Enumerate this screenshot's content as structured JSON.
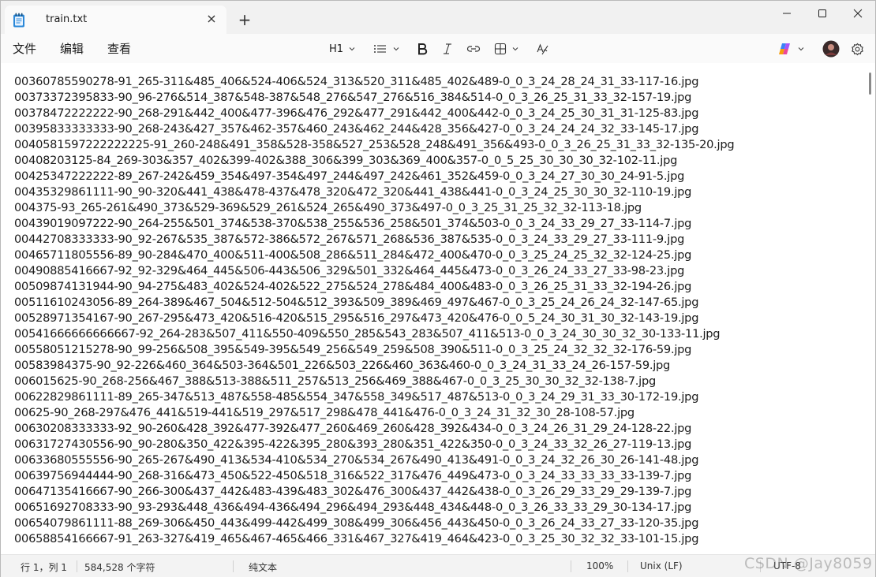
{
  "window": {
    "tab_title": "train.txt",
    "tab_close_label": "×",
    "new_tab_label": "+"
  },
  "menu": {
    "file": "文件",
    "edit": "编辑",
    "view": "查看"
  },
  "toolbar": {
    "heading_label": "H1",
    "icons": [
      "list-icon",
      "bold-icon",
      "italic-icon",
      "link-icon",
      "table-icon",
      "clear-format-icon",
      "copilot-icon",
      "avatar",
      "settings-icon"
    ]
  },
  "editor": {
    "lines": [
      "00360785590278-91_265-311&485_406&524-406&524_313&520_311&485_402&489-0_0_3_24_28_24_31_33-117-16.jpg",
      "00373372395833-90_96-276&514_387&548-387&548_276&547_276&516_384&514-0_0_3_26_25_31_33_32-157-19.jpg",
      "00378472222222-90_268-291&442_400&477-396&476_292&477_291&442_400&442-0_0_3_24_25_30_31_31-125-83.jpg",
      "00395833333333-90_268-243&427_357&462-357&460_243&462_244&428_356&427-0_0_3_24_24_24_32_33-145-17.jpg",
      "0040581597222222225-91_260-248&491_358&528-358&527_253&528_248&491_356&493-0_0_3_26_25_31_33_32-135-20.jpg",
      "00408203125-84_269-303&357_402&399-402&388_306&399_303&369_400&357-0_0_5_25_30_30_30_32-102-11.jpg",
      "00425347222222-89_267-242&459_354&497-354&497_244&497_242&461_352&459-0_0_3_24_27_30_30_24-91-5.jpg",
      "00435329861111-90_90-320&441_438&478-437&478_320&472_320&441_438&441-0_0_3_24_25_30_30_32-110-19.jpg",
      "004375-93_265-261&490_373&529-369&529_261&524_265&490_373&497-0_0_3_25_31_25_32_32-113-18.jpg",
      "00439019097222-90_264-255&501_374&538-370&538_255&536_258&501_374&503-0_0_3_24_33_29_27_33-114-7.jpg",
      "00442708333333-90_92-267&535_387&572-386&572_267&571_268&536_387&535-0_0_3_24_33_29_27_33-111-9.jpg",
      "00465711805556-89_90-284&470_400&511-400&508_286&511_284&472_400&470-0_0_3_25_24_25_32_32-124-25.jpg",
      "00490885416667-92_92-329&464_445&506-443&506_329&501_332&464_445&473-0_0_3_26_24_33_27_33-98-23.jpg",
      "00509874131944-90_94-275&483_402&524-402&522_275&524_278&484_400&483-0_0_3_26_25_31_33_32-194-26.jpg",
      "00511610243056-89_264-389&467_504&512-504&512_393&509_389&469_497&467-0_0_3_25_24_26_24_32-147-65.jpg",
      "00528971354167-90_267-295&473_420&516-420&515_295&516_297&473_420&476-0_0_5_24_30_31_30_32-143-19.jpg",
      "00541666666666667-92_264-283&507_411&550-409&550_285&543_283&507_411&513-0_0_3_24_30_30_32_30-133-11.jpg",
      "00558051215278-90_99-256&508_395&549-395&549_256&549_259&508_390&511-0_0_3_25_24_32_32_32-176-59.jpg",
      "00583984375-90_92-226&460_364&503-364&501_226&503_226&460_363&460-0_0_3_24_31_33_24_26-157-59.jpg",
      "006015625-90_268-256&467_388&513-388&511_257&513_256&469_388&467-0_0_3_25_30_30_32_32-138-7.jpg",
      "00622829861111-89_265-347&513_487&558-485&554_347&558_349&517_487&513-0_0_3_24_29_31_33_30-172-19.jpg",
      "00625-90_268-297&476_441&519-441&519_297&517_298&478_441&476-0_0_3_24_31_32_30_28-108-57.jpg",
      "00630208333333-92_90-260&428_392&477-392&477_260&469_260&428_392&434-0_0_3_24_26_31_29_24-128-22.jpg",
      "00631727430556-90_90-280&350_422&395-422&395_280&393_280&351_422&350-0_0_3_24_33_32_26_27-119-13.jpg",
      "00633680555556-90_265-267&490_413&534-410&534_270&534_267&490_413&491-0_0_3_24_32_26_30_26-141-48.jpg",
      "00639756944444-90_268-316&473_450&522-450&518_316&522_317&476_449&473-0_0_3_24_33_33_33_33-139-7.jpg",
      "00647135416667-90_266-300&437_442&483-439&483_302&476_300&437_442&438-0_0_3_26_29_33_29_29-139-7.jpg",
      "00651692708333-90_93-293&448_436&494-436&494_296&494_293&448_434&448-0_0_3_26_33_33_29_30-134-17.jpg",
      "00654079861111-88_269-306&450_443&499-442&499_308&499_306&456_443&450-0_0_3_26_24_33_27_33-120-35.jpg",
      "00658854166667-91_263-327&419_465&467-465&466_331&467_327&419_464&423-0_0_3_25_30_32_32_33-101-15.jpg"
    ]
  },
  "status": {
    "position": "行 1，列 1",
    "char_count": "584,528 个字符",
    "format": "纯文本",
    "zoom": "100%",
    "line_ending": "Unix (LF)",
    "encoding": "UTF-8"
  },
  "watermark": "CSDN @Jay8059"
}
